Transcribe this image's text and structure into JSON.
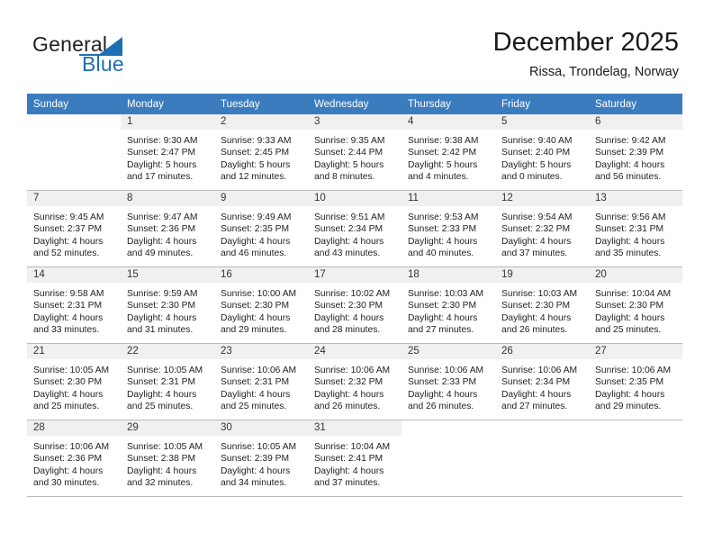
{
  "brand": {
    "name_part1": "General",
    "name_part2": "Blue",
    "accent_color": "#1b6fb5"
  },
  "header": {
    "title": "December 2025",
    "location": "Rissa, Trondelag, Norway"
  },
  "calendar": {
    "header_color": "#3b7cbf",
    "weekdays": [
      "Sunday",
      "Monday",
      "Tuesday",
      "Wednesday",
      "Thursday",
      "Friday",
      "Saturday"
    ],
    "weeks": [
      [
        {
          "day": "",
          "sunrise": "",
          "sunset": "",
          "daylight1": "",
          "daylight2": ""
        },
        {
          "day": "1",
          "sunrise": "Sunrise: 9:30 AM",
          "sunset": "Sunset: 2:47 PM",
          "daylight1": "Daylight: 5 hours",
          "daylight2": "and 17 minutes."
        },
        {
          "day": "2",
          "sunrise": "Sunrise: 9:33 AM",
          "sunset": "Sunset: 2:45 PM",
          "daylight1": "Daylight: 5 hours",
          "daylight2": "and 12 minutes."
        },
        {
          "day": "3",
          "sunrise": "Sunrise: 9:35 AM",
          "sunset": "Sunset: 2:44 PM",
          "daylight1": "Daylight: 5 hours",
          "daylight2": "and 8 minutes."
        },
        {
          "day": "4",
          "sunrise": "Sunrise: 9:38 AM",
          "sunset": "Sunset: 2:42 PM",
          "daylight1": "Daylight: 5 hours",
          "daylight2": "and 4 minutes."
        },
        {
          "day": "5",
          "sunrise": "Sunrise: 9:40 AM",
          "sunset": "Sunset: 2:40 PM",
          "daylight1": "Daylight: 5 hours",
          "daylight2": "and 0 minutes."
        },
        {
          "day": "6",
          "sunrise": "Sunrise: 9:42 AM",
          "sunset": "Sunset: 2:39 PM",
          "daylight1": "Daylight: 4 hours",
          "daylight2": "and 56 minutes."
        }
      ],
      [
        {
          "day": "7",
          "sunrise": "Sunrise: 9:45 AM",
          "sunset": "Sunset: 2:37 PM",
          "daylight1": "Daylight: 4 hours",
          "daylight2": "and 52 minutes."
        },
        {
          "day": "8",
          "sunrise": "Sunrise: 9:47 AM",
          "sunset": "Sunset: 2:36 PM",
          "daylight1": "Daylight: 4 hours",
          "daylight2": "and 49 minutes."
        },
        {
          "day": "9",
          "sunrise": "Sunrise: 9:49 AM",
          "sunset": "Sunset: 2:35 PM",
          "daylight1": "Daylight: 4 hours",
          "daylight2": "and 46 minutes."
        },
        {
          "day": "10",
          "sunrise": "Sunrise: 9:51 AM",
          "sunset": "Sunset: 2:34 PM",
          "daylight1": "Daylight: 4 hours",
          "daylight2": "and 43 minutes."
        },
        {
          "day": "11",
          "sunrise": "Sunrise: 9:53 AM",
          "sunset": "Sunset: 2:33 PM",
          "daylight1": "Daylight: 4 hours",
          "daylight2": "and 40 minutes."
        },
        {
          "day": "12",
          "sunrise": "Sunrise: 9:54 AM",
          "sunset": "Sunset: 2:32 PM",
          "daylight1": "Daylight: 4 hours",
          "daylight2": "and 37 minutes."
        },
        {
          "day": "13",
          "sunrise": "Sunrise: 9:56 AM",
          "sunset": "Sunset: 2:31 PM",
          "daylight1": "Daylight: 4 hours",
          "daylight2": "and 35 minutes."
        }
      ],
      [
        {
          "day": "14",
          "sunrise": "Sunrise: 9:58 AM",
          "sunset": "Sunset: 2:31 PM",
          "daylight1": "Daylight: 4 hours",
          "daylight2": "and 33 minutes."
        },
        {
          "day": "15",
          "sunrise": "Sunrise: 9:59 AM",
          "sunset": "Sunset: 2:30 PM",
          "daylight1": "Daylight: 4 hours",
          "daylight2": "and 31 minutes."
        },
        {
          "day": "16",
          "sunrise": "Sunrise: 10:00 AM",
          "sunset": "Sunset: 2:30 PM",
          "daylight1": "Daylight: 4 hours",
          "daylight2": "and 29 minutes."
        },
        {
          "day": "17",
          "sunrise": "Sunrise: 10:02 AM",
          "sunset": "Sunset: 2:30 PM",
          "daylight1": "Daylight: 4 hours",
          "daylight2": "and 28 minutes."
        },
        {
          "day": "18",
          "sunrise": "Sunrise: 10:03 AM",
          "sunset": "Sunset: 2:30 PM",
          "daylight1": "Daylight: 4 hours",
          "daylight2": "and 27 minutes."
        },
        {
          "day": "19",
          "sunrise": "Sunrise: 10:03 AM",
          "sunset": "Sunset: 2:30 PM",
          "daylight1": "Daylight: 4 hours",
          "daylight2": "and 26 minutes."
        },
        {
          "day": "20",
          "sunrise": "Sunrise: 10:04 AM",
          "sunset": "Sunset: 2:30 PM",
          "daylight1": "Daylight: 4 hours",
          "daylight2": "and 25 minutes."
        }
      ],
      [
        {
          "day": "21",
          "sunrise": "Sunrise: 10:05 AM",
          "sunset": "Sunset: 2:30 PM",
          "daylight1": "Daylight: 4 hours",
          "daylight2": "and 25 minutes."
        },
        {
          "day": "22",
          "sunrise": "Sunrise: 10:05 AM",
          "sunset": "Sunset: 2:31 PM",
          "daylight1": "Daylight: 4 hours",
          "daylight2": "and 25 minutes."
        },
        {
          "day": "23",
          "sunrise": "Sunrise: 10:06 AM",
          "sunset": "Sunset: 2:31 PM",
          "daylight1": "Daylight: 4 hours",
          "daylight2": "and 25 minutes."
        },
        {
          "day": "24",
          "sunrise": "Sunrise: 10:06 AM",
          "sunset": "Sunset: 2:32 PM",
          "daylight1": "Daylight: 4 hours",
          "daylight2": "and 26 minutes."
        },
        {
          "day": "25",
          "sunrise": "Sunrise: 10:06 AM",
          "sunset": "Sunset: 2:33 PM",
          "daylight1": "Daylight: 4 hours",
          "daylight2": "and 26 minutes."
        },
        {
          "day": "26",
          "sunrise": "Sunrise: 10:06 AM",
          "sunset": "Sunset: 2:34 PM",
          "daylight1": "Daylight: 4 hours",
          "daylight2": "and 27 minutes."
        },
        {
          "day": "27",
          "sunrise": "Sunrise: 10:06 AM",
          "sunset": "Sunset: 2:35 PM",
          "daylight1": "Daylight: 4 hours",
          "daylight2": "and 29 minutes."
        }
      ],
      [
        {
          "day": "28",
          "sunrise": "Sunrise: 10:06 AM",
          "sunset": "Sunset: 2:36 PM",
          "daylight1": "Daylight: 4 hours",
          "daylight2": "and 30 minutes."
        },
        {
          "day": "29",
          "sunrise": "Sunrise: 10:05 AM",
          "sunset": "Sunset: 2:38 PM",
          "daylight1": "Daylight: 4 hours",
          "daylight2": "and 32 minutes."
        },
        {
          "day": "30",
          "sunrise": "Sunrise: 10:05 AM",
          "sunset": "Sunset: 2:39 PM",
          "daylight1": "Daylight: 4 hours",
          "daylight2": "and 34 minutes."
        },
        {
          "day": "31",
          "sunrise": "Sunrise: 10:04 AM",
          "sunset": "Sunset: 2:41 PM",
          "daylight1": "Daylight: 4 hours",
          "daylight2": "and 37 minutes."
        },
        {
          "day": "",
          "sunrise": "",
          "sunset": "",
          "daylight1": "",
          "daylight2": ""
        },
        {
          "day": "",
          "sunrise": "",
          "sunset": "",
          "daylight1": "",
          "daylight2": ""
        },
        {
          "day": "",
          "sunrise": "",
          "sunset": "",
          "daylight1": "",
          "daylight2": ""
        }
      ]
    ]
  }
}
